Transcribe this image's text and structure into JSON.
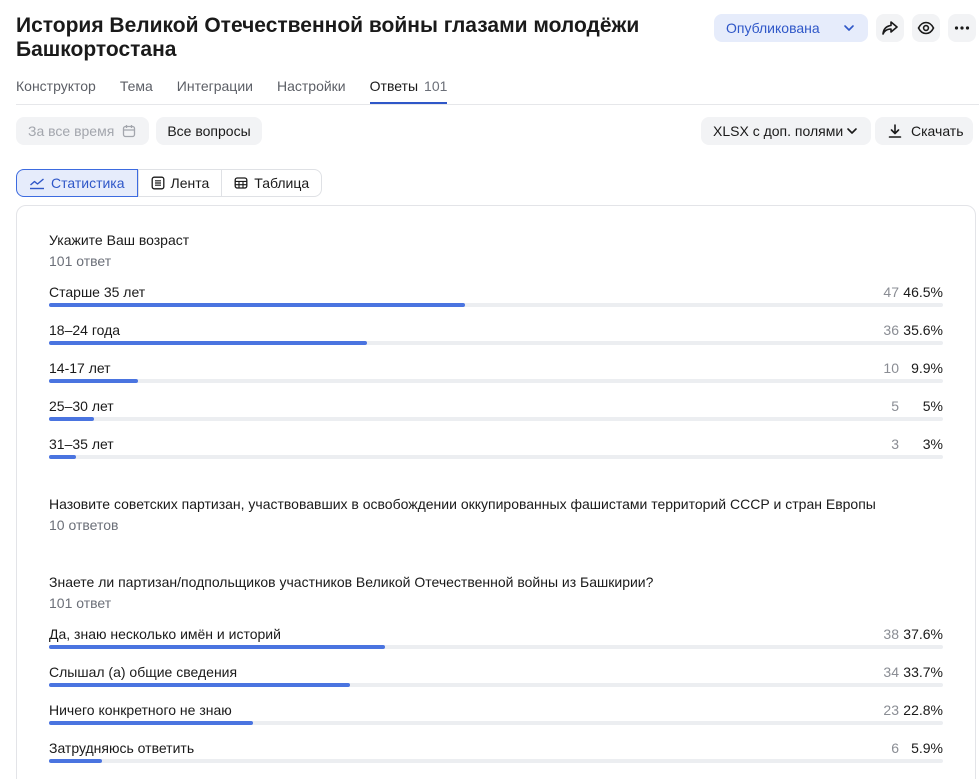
{
  "header": {
    "title": "История Великой Отечественной войны глазами молодёжи Башкортостана",
    "status_label": "Опубликована"
  },
  "tabs": [
    {
      "label": "Конструктор"
    },
    {
      "label": "Тема"
    },
    {
      "label": "Интеграции"
    },
    {
      "label": "Настройки"
    },
    {
      "label": "Ответы",
      "count": "101",
      "active": true
    }
  ],
  "filters": {
    "date_placeholder": "За все время",
    "questions_label": "Все вопросы",
    "format_label": "XLSX с доп. полями",
    "download_label": "Скачать"
  },
  "views": [
    {
      "label": "Статистика",
      "icon": "chart-icon",
      "active": true
    },
    {
      "label": "Лента",
      "icon": "list-icon"
    },
    {
      "label": "Таблица",
      "icon": "table-icon"
    }
  ],
  "questions": [
    {
      "title": "Укажите Ваш возраст",
      "subtitle": "101 ответ",
      "options": [
        {
          "label": "Старше 35 лет",
          "count": "47",
          "pct": "46.5%",
          "share": 0.465
        },
        {
          "label": "18–24 года",
          "count": "36",
          "pct": "35.6%",
          "share": 0.356
        },
        {
          "label": "14-17 лет",
          "count": "10",
          "pct": "9.9%",
          "share": 0.099
        },
        {
          "label": "25–30 лет",
          "count": "5",
          "pct": "5%",
          "share": 0.05
        },
        {
          "label": "31–35 лет",
          "count": "3",
          "pct": "3%",
          "share": 0.03
        }
      ]
    },
    {
      "title": "Назовите советских партизан, участвовавших в освобождении оккупированных фашистами территорий СССР и стран Европы",
      "subtitle": "10 ответов",
      "options": []
    },
    {
      "title": "Знаете ли партизан/подпольщиков участников Великой Отечественной войны из Башкирии?",
      "subtitle": "101 ответ",
      "options": [
        {
          "label": "Да, знаю несколько имён и историй",
          "count": "38",
          "pct": "37.6%",
          "share": 0.376
        },
        {
          "label": "Слышал (а) общие сведения",
          "count": "34",
          "pct": "33.7%",
          "share": 0.337
        },
        {
          "label": "Ничего конкретного не знаю",
          "count": "23",
          "pct": "22.8%",
          "share": 0.228
        },
        {
          "label": "Затрудняюсь ответить",
          "count": "6",
          "pct": "5.9%",
          "share": 0.059
        }
      ]
    }
  ],
  "colors": {
    "accent": "#2f57c8",
    "bar": "#4a74e0",
    "track": "#eceef1"
  }
}
